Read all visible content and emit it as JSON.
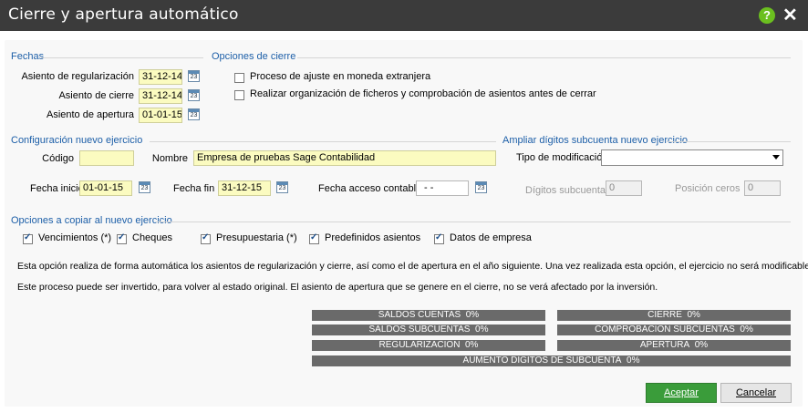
{
  "window": {
    "title": "Cierre y apertura automático",
    "help_glyph": "?",
    "close_glyph": "✕"
  },
  "fechas": {
    "section": "Fechas",
    "rows": [
      {
        "label": "Asiento de regularización",
        "value": "31-12-14"
      },
      {
        "label": "Asiento de cierre",
        "value": "31-12-14"
      },
      {
        "label": "Asiento de apertura",
        "value": "01-01-15"
      }
    ]
  },
  "opciones_cierre": {
    "section": "Opciones de cierre",
    "items": [
      {
        "label": "Proceso de ajuste en moneda extranjera",
        "checked": false
      },
      {
        "label": "Realizar organización de ficheros y comprobación de asientos antes de cerrar",
        "checked": false
      }
    ]
  },
  "config": {
    "section": "Configuración nuevo ejercicio",
    "codigo_label": "Código",
    "codigo_value": "",
    "nombre_label": "Nombre",
    "nombre_value": "Empresa de pruebas Sage Contabilidad",
    "fecha_inicio_label": "Fecha inicio",
    "fecha_inicio_value": "01-01-15",
    "fecha_fin_label": "Fecha fin",
    "fecha_fin_value": "31-12-15",
    "fecha_acceso_label": "Fecha acceso contable",
    "fecha_acceso_value": "- -"
  },
  "ampliar": {
    "section": "Ampliar dígitos subcuenta nuevo ejercicio",
    "tipo_label": "Tipo de modificación",
    "tipo_value": "",
    "digitos_label": "Dígitos subcuenta",
    "digitos_value": "0",
    "posicion_label": "Posición ceros",
    "posicion_value": "0"
  },
  "copiar": {
    "section": "Opciones a copiar al nuevo ejercicio",
    "items": [
      {
        "label": "Vencimientos (*)",
        "checked": true
      },
      {
        "label": "Cheques",
        "checked": true
      },
      {
        "label": "Presupuestaria (*)",
        "checked": true
      },
      {
        "label": "Predefinidos asientos",
        "checked": true
      },
      {
        "label": "Datos de empresa",
        "checked": true
      }
    ]
  },
  "info": {
    "line1": "Esta opción realiza de forma automática los asientos de regularización y cierre, así como el de apertura en el año siguiente. Una vez realizada esta opción, el ejercicio no será modificable.",
    "line2": "Este proceso puede ser invertido, para volver al estado original. El asiento de apertura que se genere en el cierre, no se verá afectado por la inversión."
  },
  "progress": [
    {
      "label": "SALDOS CUENTAS",
      "percent": "0%"
    },
    {
      "label": "CIERRE",
      "percent": "0%"
    },
    {
      "label": "SALDOS SUBCUENTAS",
      "percent": "0%"
    },
    {
      "label": "COMPROBACION SUBCUENTAS",
      "percent": "0%"
    },
    {
      "label": "REGULARIZACION",
      "percent": "0%"
    },
    {
      "label": "APERTURA",
      "percent": "0%"
    },
    {
      "label": "AUMENTO DIGITOS DE SUBCUENTA",
      "percent": "0%"
    }
  ],
  "buttons": {
    "accept": "Aceptar",
    "cancel": "Cancelar"
  },
  "colors": {
    "titlebar": "#3b3b3b",
    "section": "#1d5fa8",
    "accept": "#3a9c3a",
    "help": "#6bbf1f",
    "progress": "#6a6a6a",
    "input_yellow": "#fbfbc0"
  }
}
